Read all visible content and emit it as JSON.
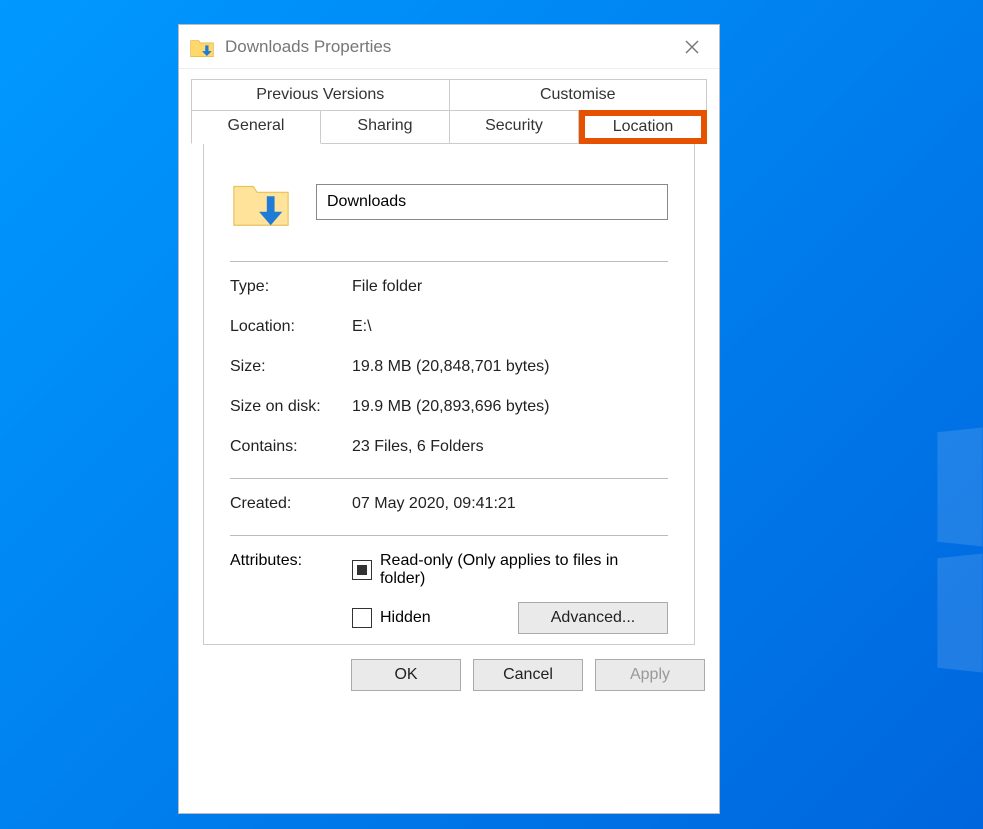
{
  "window": {
    "title": "Downloads Properties"
  },
  "tabs": {
    "top": [
      {
        "label": "Previous Versions"
      },
      {
        "label": "Customise"
      }
    ],
    "bottom": [
      {
        "label": "General"
      },
      {
        "label": "Sharing"
      },
      {
        "label": "Security"
      },
      {
        "label": "Location"
      }
    ],
    "highlighted": "Location",
    "active": "General"
  },
  "general": {
    "folder_name": "Downloads",
    "type_label": "Type:",
    "type_value": "File folder",
    "location_label": "Location:",
    "location_value": "E:\\",
    "size_label": "Size:",
    "size_value": "19.8 MB (20,848,701 bytes)",
    "size_on_disk_label": "Size on disk:",
    "size_on_disk_value": "19.9 MB (20,893,696 bytes)",
    "contains_label": "Contains:",
    "contains_value": "23 Files, 6 Folders",
    "created_label": "Created:",
    "created_value": "07 May 2020, 09:41:21",
    "attributes_label": "Attributes:",
    "readonly_label": "Read-only (Only applies to files in folder)",
    "hidden_label": "Hidden",
    "advanced_button": "Advanced..."
  },
  "buttons": {
    "ok": "OK",
    "cancel": "Cancel",
    "apply": "Apply"
  }
}
